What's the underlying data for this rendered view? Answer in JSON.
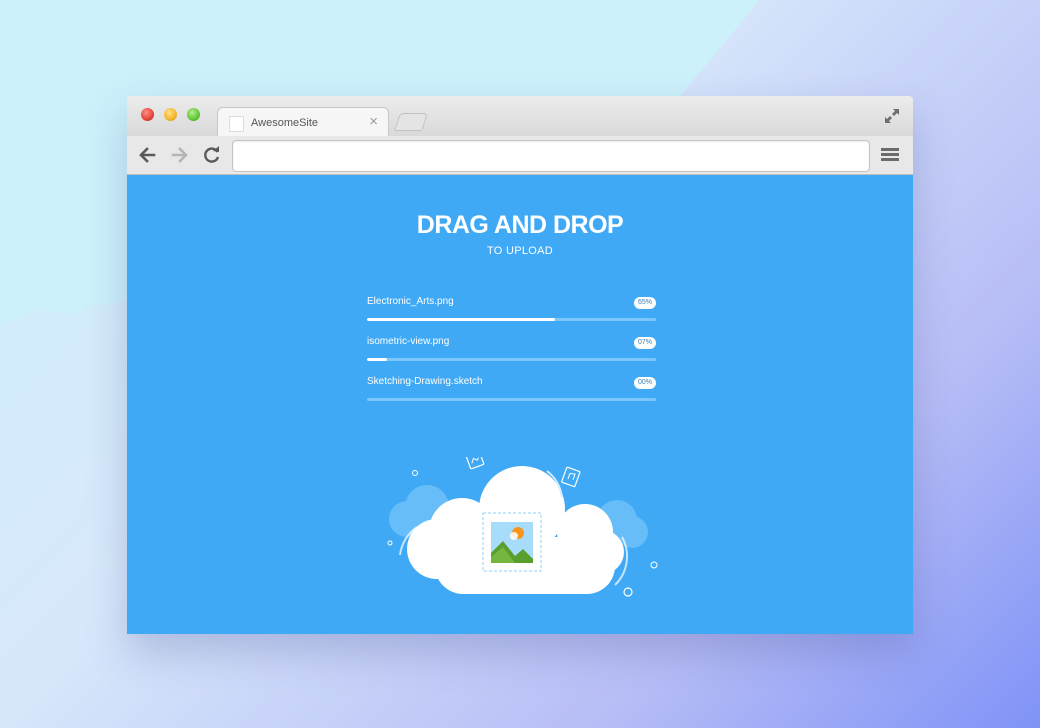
{
  "browser": {
    "tab_title": "AwesomeSite",
    "tab_close": "×",
    "address_value": "",
    "icons": [
      "back-arrow-icon",
      "forward-arrow-icon",
      "reload-icon",
      "menu-icon",
      "fullscreen-icon",
      "favicon-icon"
    ]
  },
  "page": {
    "heading": "DRAG AND DROP",
    "subheading": "TO UPLOAD"
  },
  "uploads": [
    {
      "name": "Electronic_Arts.png",
      "percent_label": "65%",
      "progress": 0.65
    },
    {
      "name": "isometric-view.png",
      "percent_label": "07%",
      "progress": 0.07
    },
    {
      "name": "Sketching-Drawing.sketch",
      "percent_label": "00%",
      "progress": 0.0
    }
  ],
  "colors": {
    "content_background": "#3fa9f5",
    "track": "#7cc6fb",
    "fill": "#ffffff"
  }
}
